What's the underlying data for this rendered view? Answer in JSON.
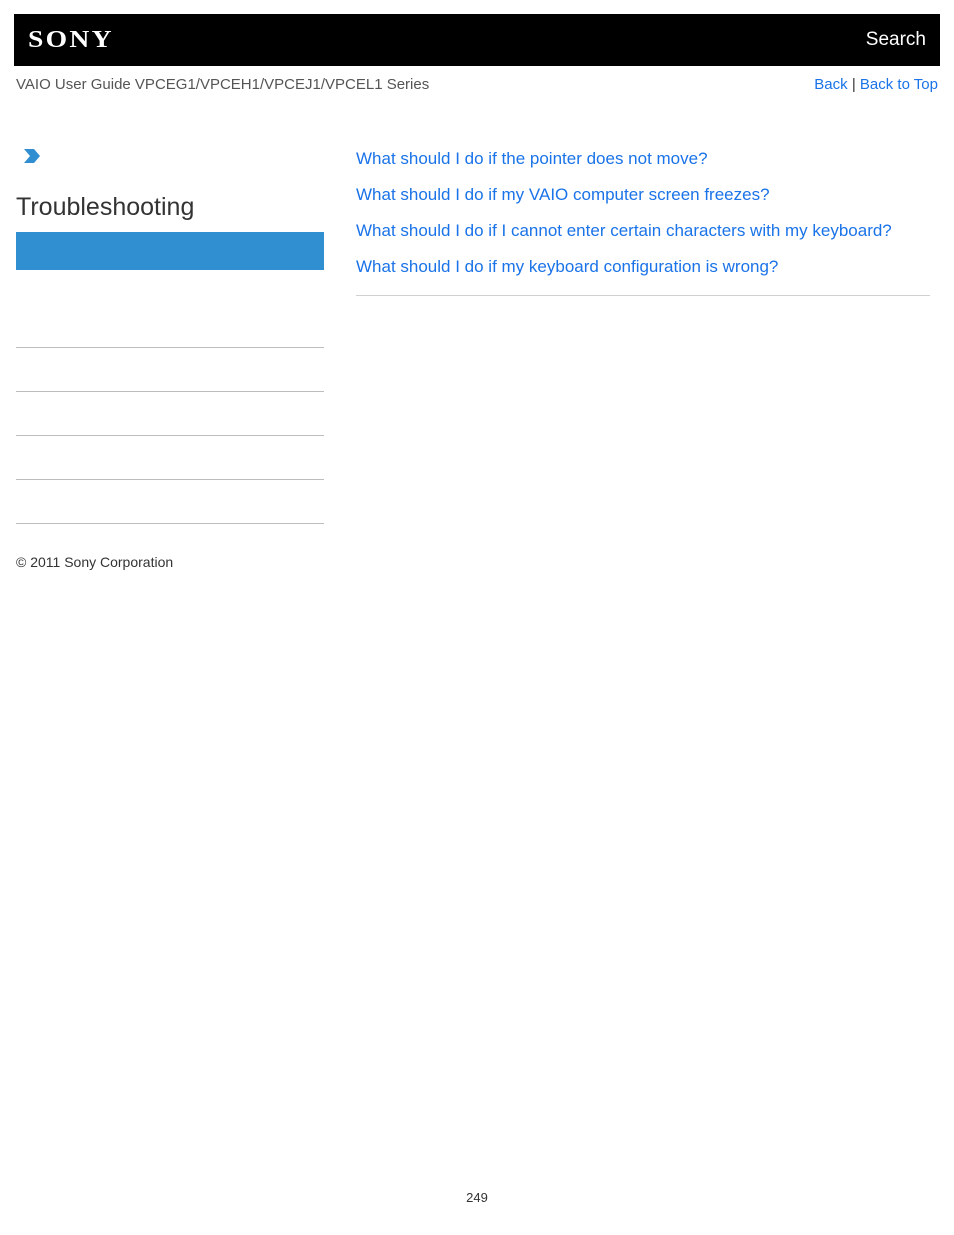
{
  "header": {
    "logo_text": "SONY",
    "search_label": "Search"
  },
  "subheader": {
    "guide_title": "VAIO User Guide VPCEG1/VPCEH1/VPCEJ1/VPCEL1 Series",
    "back_label": "Back",
    "separator": " | ",
    "back_to_top_label": "Back to Top"
  },
  "sidebar": {
    "section_title": "Troubleshooting"
  },
  "faq": {
    "items": [
      "What should I do if the pointer does not move?",
      "What should I do if my VAIO computer screen freezes?",
      "What should I do if I cannot enter certain characters with my keyboard?",
      "What should I do if my keyboard configuration is wrong?"
    ]
  },
  "footer": {
    "copyright": "© 2011 Sony Corporation"
  },
  "page_number": "249"
}
